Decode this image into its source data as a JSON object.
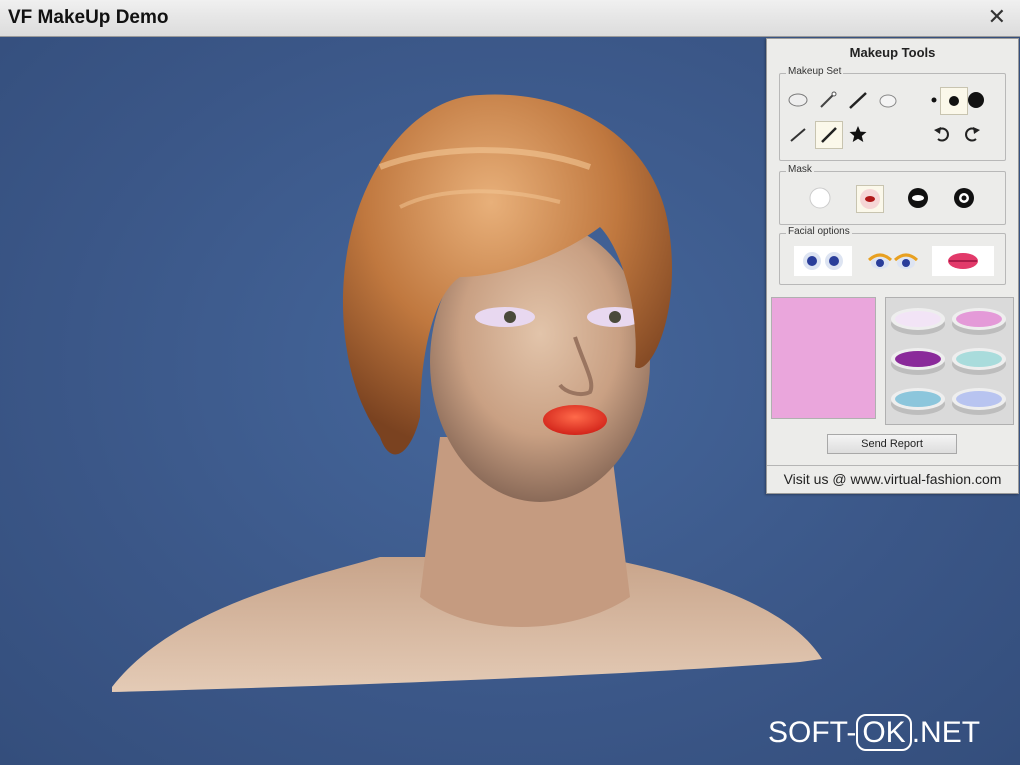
{
  "window": {
    "title": "VF MakeUp Demo",
    "close_label": "✕"
  },
  "panel": {
    "title": "Makeup Tools",
    "makeup_set_label": "Makeup Set",
    "mask_label": "Mask",
    "facial_options_label": "Facial options",
    "send_report_label": "Send Report",
    "visit_text": "Visit us @ www.virtual-fashion.com"
  },
  "colors": {
    "preview": "#eaa6dc",
    "pots": [
      "#f2e4f6",
      "#e49ad8",
      "#8a2a9a",
      "#a9dcdc",
      "#8cc6dc",
      "#b8c4f0"
    ]
  },
  "watermark": {
    "prefix": "SOFT-",
    "boxed": "OK",
    "suffix": ".NET"
  }
}
